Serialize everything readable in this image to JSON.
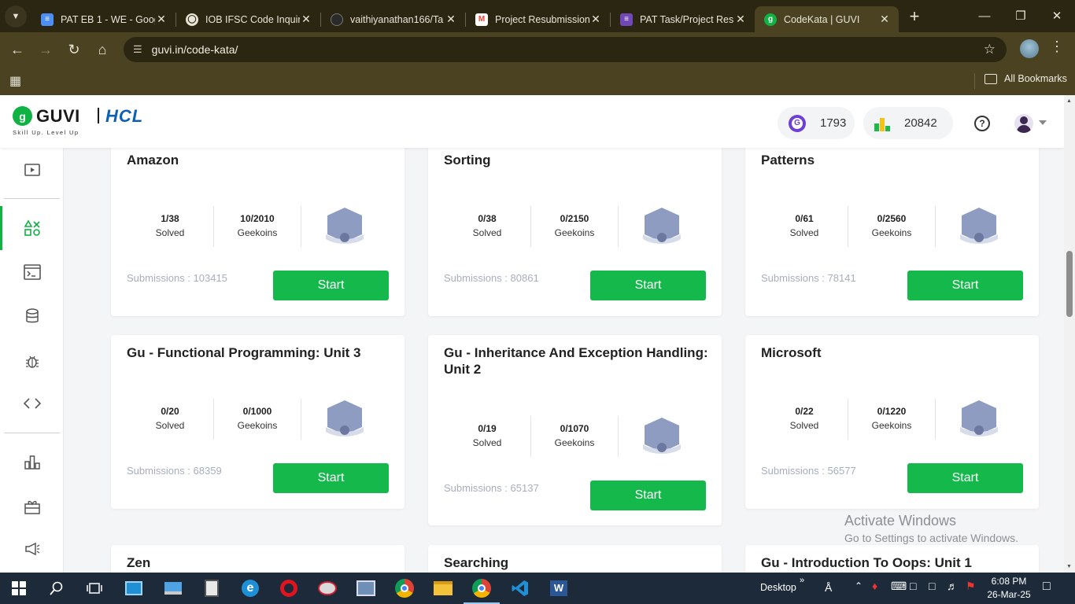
{
  "browser": {
    "tabs": [
      {
        "title": "PAT EB 1 - WE - Goog",
        "favicon": "docs-icon",
        "color": "#4d8ef7"
      },
      {
        "title": "IOB IFSC Code Inquiry",
        "favicon": "globe-icon",
        "color": "#bdbdbd"
      },
      {
        "title": "vaithiyanathan166/Ta",
        "favicon": "github-icon",
        "color": "#2a2a2a"
      },
      {
        "title": "Project Resubmission",
        "favicon": "gmail-icon",
        "color": "#ea4335"
      },
      {
        "title": "PAT Task/Project Resu",
        "favicon": "forms-icon",
        "color": "#7248b9"
      },
      {
        "title": "CodeKata | GUVI",
        "favicon": "guvi-icon",
        "color": "#10b243"
      }
    ],
    "url": "guvi.in/code-kata/",
    "all_bookmarks": "All Bookmarks"
  },
  "header": {
    "logo_guvi": "GUVI",
    "logo_hcl": "HCL",
    "tagline": "Skill Up. Level Up",
    "geekoins": "1793",
    "rank": "20842"
  },
  "cards": [
    {
      "title": "Amazon",
      "solved": "1/38",
      "geekoins": "10/2010",
      "submissions": "Submissions : 103415",
      "button": "Start"
    },
    {
      "title": "Sorting",
      "solved": "0/38",
      "geekoins": "0/2150",
      "submissions": "Submissions : 80861",
      "button": "Start"
    },
    {
      "title": "Patterns",
      "solved": "0/61",
      "geekoins": "0/2560",
      "submissions": "Submissions : 78141",
      "button": "Start"
    },
    {
      "title": "Gu - Functional Programming: Unit 3",
      "solved": "0/20",
      "geekoins": "0/1000",
      "submissions": "Submissions : 68359",
      "button": "Start"
    },
    {
      "title": "Gu - Inheritance And Exception Handling: Unit 2",
      "solved": "0/19",
      "geekoins": "0/1070",
      "submissions": "Submissions : 65137",
      "button": "Start"
    },
    {
      "title": "Microsoft",
      "solved": "0/22",
      "geekoins": "0/1220",
      "submissions": "Submissions : 56577",
      "button": "Start"
    },
    {
      "title": "Zen"
    },
    {
      "title": "Searching"
    },
    {
      "title": "Gu - Introduction To Oops: Unit 1"
    }
  ],
  "labels": {
    "solved": "Solved",
    "geekoins": "Geekoins"
  },
  "watermark": {
    "line1": "Activate Windows",
    "line2": "Go to Settings to activate Windows."
  },
  "taskbar": {
    "desktop": "Desktop",
    "time": "6:08 PM",
    "date": "26-Mar-25"
  }
}
